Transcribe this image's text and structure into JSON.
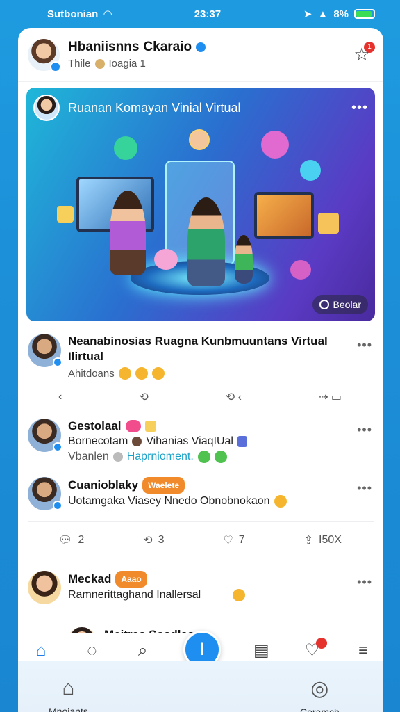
{
  "status_bar": {
    "carrier": "Sutbonian",
    "time": "23:37",
    "battery": "8%"
  },
  "header": {
    "name": "Hbaniisnns",
    "name_suffix": "Ckaraio",
    "subtitle_prefix": "Thile",
    "subtitle_suffix": "Ioagia 1",
    "notification_count": "1"
  },
  "hero": {
    "title": "Ruanan Komayan Vinial Virtual",
    "button_label": "Beolar"
  },
  "post1": {
    "title": "Neanabinosias Ruagna Kunbmuuntans Virtual Ilirtual",
    "subtitle": "Ahitdoans"
  },
  "post1_actions": [
    "‹",
    "⟲",
    "⟲ ‹",
    "⇢ ▭"
  ],
  "post2": {
    "name": "Gestolaal",
    "line1_left": "Bornecotam",
    "line1_right": "Vihanias ViaqIUal",
    "line2_left": "Vbanlen",
    "line2_link": "Haprnioment."
  },
  "post3": {
    "name": "Cuanioblaky",
    "tag": "Waelete",
    "text": "Uotamgaka Viasey Nnedo Obnobnokaon"
  },
  "post3_actions": {
    "comments": "2",
    "reposts": "3",
    "likes": "7",
    "shares": "I50X"
  },
  "post4": {
    "name": "Meckad",
    "tag": "Aaao",
    "text": "Ramnerittaghand Inallersal"
  },
  "post5": {
    "name": "Meitras Sosdlas"
  },
  "bottom": {
    "left_label": "Mnoiants",
    "right_label": "Coramch"
  },
  "colors": {
    "accent": "#1f8ef1",
    "notification": "#e5322d",
    "tag": "#f08a2a"
  }
}
